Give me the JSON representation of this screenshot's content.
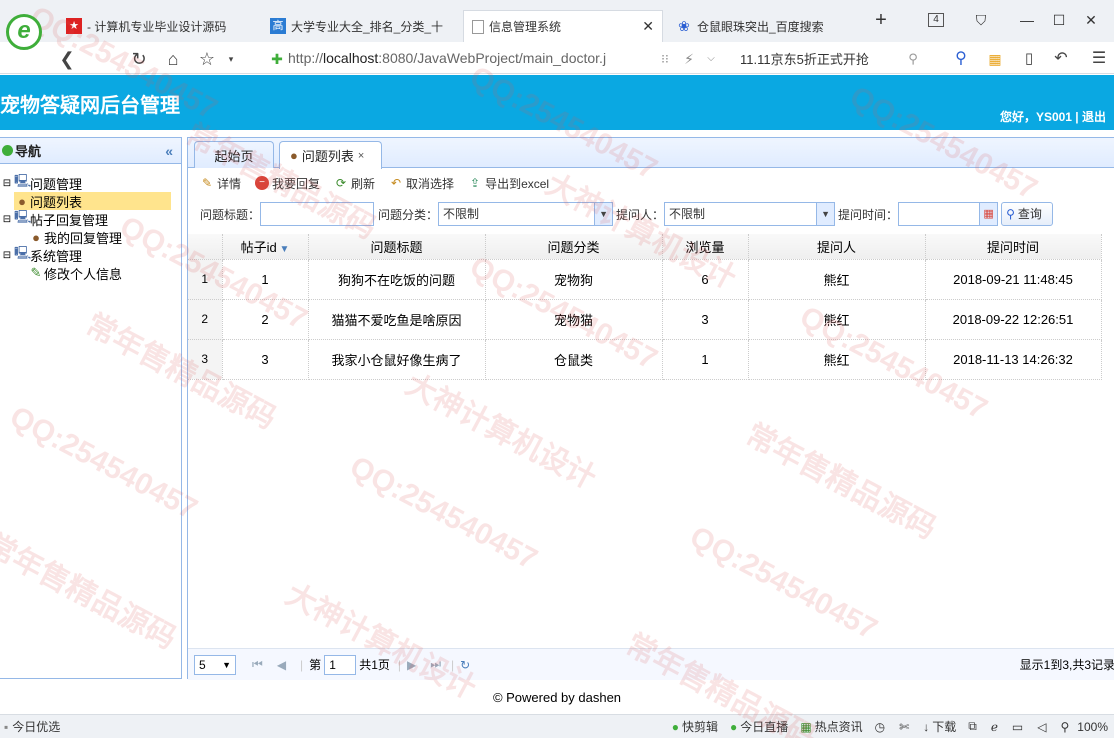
{
  "browser": {
    "tabs": [
      {
        "label": "- 计算机专业毕业设计源码",
        "icon": "flag-icon"
      },
      {
        "label": "大学专业大全_排名_分类_十",
        "icon": "gao-icon"
      },
      {
        "label": "信息管理系统",
        "icon": "page-icon"
      },
      {
        "label": "仓鼠眼珠突出_百度搜索",
        "icon": "paw-icon"
      }
    ],
    "tab_count": "4",
    "url_prefix": "http://",
    "url_host": "localhost",
    "url_rest": ":8080/JavaWebProject/main_doctor.j",
    "search_text": "11.11京东5折正式开抢"
  },
  "app": {
    "title": "宠物答疑网后台管理",
    "greeting": "您好，YS001 | 退出"
  },
  "nav": {
    "title": "导航",
    "items": [
      {
        "label": "问题管理",
        "level": 0
      },
      {
        "label": "问题列表",
        "level": 1,
        "selected": true
      },
      {
        "label": "帖子回复管理",
        "level": 0
      },
      {
        "label": "我的回复管理",
        "level": 1
      },
      {
        "label": "系统管理",
        "level": 0
      },
      {
        "label": "修改个人信息",
        "level": 1
      }
    ]
  },
  "main": {
    "tabs": [
      {
        "label": "起始页"
      },
      {
        "label": "问题列表",
        "closable": true
      }
    ],
    "toolbar": [
      {
        "label": "详情",
        "icon": "edit-icon"
      },
      {
        "label": "我要回复",
        "icon": "remove-icon"
      },
      {
        "label": "刷新",
        "icon": "reload-icon"
      },
      {
        "label": "取消选择",
        "icon": "undo-icon"
      },
      {
        "label": "导出到excel",
        "icon": "export-icon"
      }
    ],
    "search": {
      "title_label": "问题标题：",
      "title_value": "",
      "category_label": "问题分类：",
      "category_value": "不限制",
      "asker_label": "提问人：",
      "asker_value": "不限制",
      "time_label": "提问时间：",
      "time_value": "",
      "query_button": "查询"
    },
    "grid": {
      "columns": [
        "帖子id",
        "问题标题",
        "问题分类",
        "浏览量",
        "提问人",
        "提问时间"
      ],
      "rows": [
        {
          "n": "1",
          "id": "1",
          "title": "狗狗不在吃饭的问题",
          "category": "宠物狗",
          "views": "6",
          "asker": "熊红",
          "time": "2018-09-21 11:48:45"
        },
        {
          "n": "2",
          "id": "2",
          "title": "猫猫不爱吃鱼是啥原因",
          "category": "宠物猫",
          "views": "3",
          "asker": "熊红",
          "time": "2018-09-22 12:26:51"
        },
        {
          "n": "3",
          "id": "3",
          "title": "我家小仓鼠好像生病了",
          "category": "仓鼠类",
          "views": "1",
          "asker": "熊红",
          "time": "2018-11-13 14:26:32"
        }
      ]
    },
    "pager": {
      "page_size": "5",
      "page_prefix": "第",
      "page_value": "1",
      "page_total": "共1页",
      "summary": "显示1到3,共3记录"
    }
  },
  "footer": "© Powered by dashen",
  "statusbar": {
    "left": "今日优选",
    "items": [
      "快剪辑",
      "今日直播",
      "热点资讯",
      "下载"
    ],
    "zoom": "100%"
  },
  "watermarks": [
    "QQ:254540457",
    "常年售精品源码",
    "大神计算机设计"
  ]
}
